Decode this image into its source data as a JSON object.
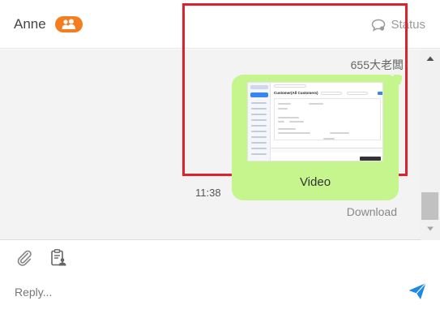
{
  "header": {
    "contact_name": "Anne",
    "badge_icon": "group-icon",
    "badge_color": "#f47d20",
    "status_label": "Status"
  },
  "message": {
    "sender": "655大老闆",
    "caption": "Video",
    "time": "11:38",
    "download_label": "Download",
    "bubble_color": "#c6f58e",
    "highlight_color": "#e0202a",
    "thumbnail_title": "Customer(All Customers)"
  },
  "composer": {
    "placeholder": "Reply...",
    "attach_icon": "paperclip-icon",
    "template_icon": "clipboard-user-icon",
    "send_icon": "send-icon",
    "send_color": "#1e88e5"
  }
}
